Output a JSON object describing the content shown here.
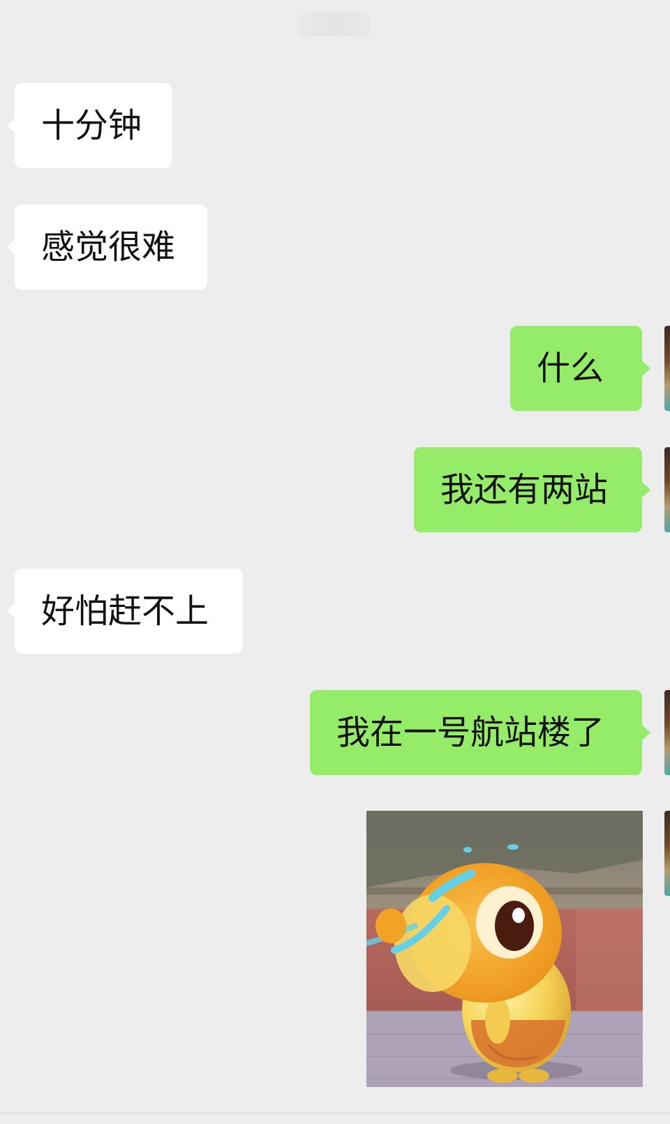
{
  "messages": [
    {
      "side": "left",
      "text": "十分钟"
    },
    {
      "side": "left",
      "text": "感觉很难"
    },
    {
      "side": "right",
      "text": "什么"
    },
    {
      "side": "right",
      "text": "我还有两站"
    },
    {
      "side": "left",
      "text": "好怕赶不上"
    },
    {
      "side": "right",
      "text": "我在一号航站楼了"
    }
  ],
  "sticker": {
    "icon": "crying-cartoon-chick-sticker"
  },
  "colors": {
    "background": "#ededed",
    "incoming_bubble": "#ffffff",
    "outgoing_bubble": "#95ec69",
    "text": "#111111"
  }
}
